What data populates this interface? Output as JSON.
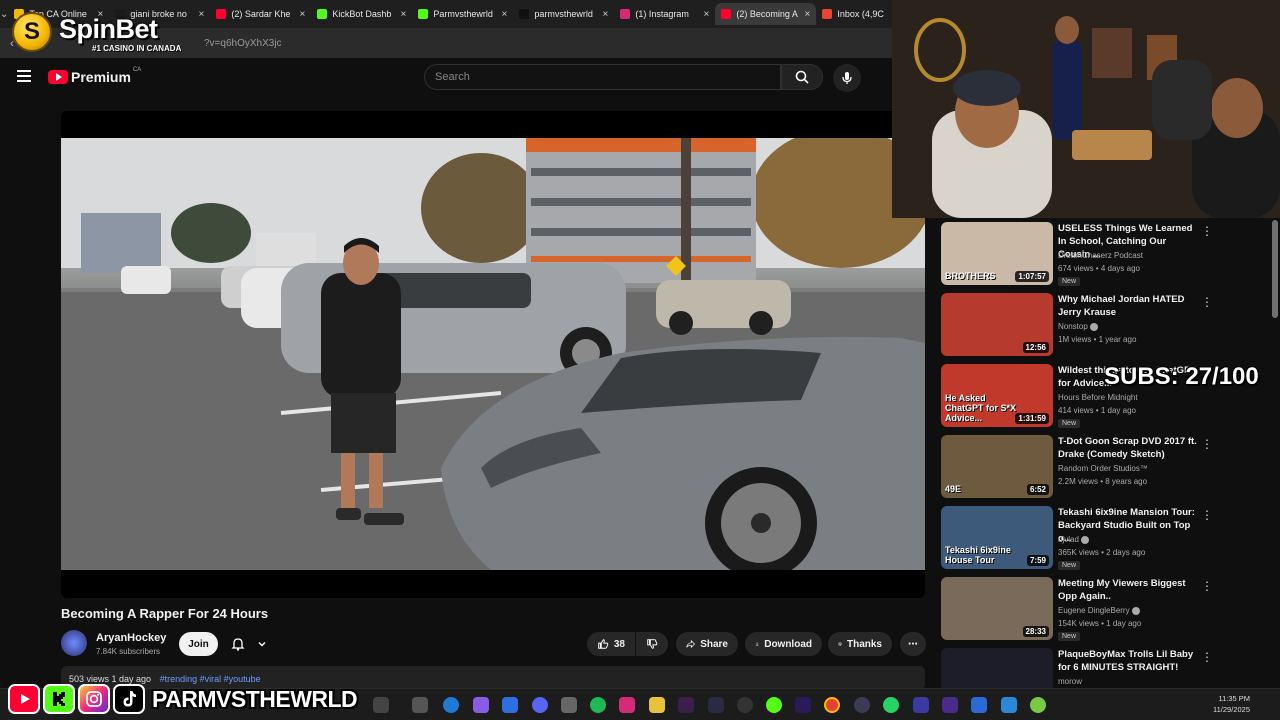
{
  "browser": {
    "tabs": [
      {
        "label": "Top CA Online",
        "fav_color": "#f5b800",
        "active": false
      },
      {
        "label": "giani broke no",
        "fav_color": "#1a1a1a",
        "active": false
      },
      {
        "label": "(2) Sardar Khe",
        "fav_color": "#ff0033",
        "active": false
      },
      {
        "label": "KickBot Dashb",
        "fav_color": "#53fc18",
        "active": false
      },
      {
        "label": "Parmvsthewrld",
        "fav_color": "#53fc18",
        "active": false
      },
      {
        "label": "parmvsthewrld",
        "fav_color": "#111111",
        "active": false
      },
      {
        "label": "(1) Instagram",
        "fav_color": "#d62976",
        "active": false
      },
      {
        "label": "(2) Becoming A",
        "fav_color": "#ff0033",
        "active": true
      },
      {
        "label": "Inbox (4,9C",
        "fav_color": "#ea4335",
        "active": false
      }
    ],
    "close_glyph": "×",
    "url_visible": "?v=q6hOyXhX3jc"
  },
  "overlay_brand": {
    "name": "SpinBet",
    "coin_letter": "S",
    "tagline": "#1 CASINO IN CANADA"
  },
  "youtube": {
    "logo_text": "Premium",
    "region": "CA",
    "search_placeholder": "Search"
  },
  "video": {
    "title": "Becoming A Rapper For 24 Hours",
    "channel": "AryanHockey",
    "subscribers": "7.84K subscribers",
    "join_label": "Join",
    "likes": "38",
    "share_label": "Share",
    "download_label": "Download",
    "thanks_label": "Thanks",
    "more_glyph": "⋯",
    "desc_meta": "503 views  1 day ago",
    "desc_tags": "#trending #viral #youtube"
  },
  "recommendations": [
    {
      "title": "USELESS Things We Learned In School, Catching Our Cousin ...",
      "channel": "DreamChaserz Podcast",
      "verified": false,
      "meta": "674 views • 4 days ago",
      "new": true,
      "duration": "1:07:57",
      "thumb_text": "BROTHERS",
      "thumb_color": "#c9b9a6"
    },
    {
      "title": "Why Michael Jordan HATED Jerry Krause",
      "channel": "Nonstop",
      "verified": true,
      "meta": "1M views • 1 year ago",
      "new": false,
      "duration": "12:56",
      "thumb_text": "",
      "thumb_color": "#b73a2e"
    },
    {
      "title": "Wildest things to ask ChatGPT for Advice...",
      "channel": "Hours Before Midnight",
      "verified": false,
      "meta": "414 views • 1 day ago",
      "new": true,
      "duration": "1:31:59",
      "thumb_text": "He Asked ChatGPT for S*X Advice...",
      "thumb_color": "#c0392b"
    },
    {
      "title": "T-Dot Goon Scrap DVD 2017 ft. Drake (Comedy Sketch)",
      "channel": "Random Order Studios™",
      "verified": false,
      "meta": "2.2M views • 8 years ago",
      "new": false,
      "duration": "6:52",
      "thumb_text": "49E",
      "thumb_color": "#6d5a3f"
    },
    {
      "title": "Tekashi 6ix9ine Mansion Tour: Backyard Studio Built on Top o...",
      "channel": "djvlad",
      "verified": true,
      "meta": "365K views • 2 days ago",
      "new": true,
      "duration": "7:59",
      "thumb_text": "Tekashi 6ix9ine House Tour",
      "thumb_color": "#3d5a7a"
    },
    {
      "title": "Meeting My Viewers Biggest Opp Again..",
      "channel": "Eugene DingleBerry",
      "verified": true,
      "meta": "154K views • 1 day ago",
      "new": true,
      "duration": "28:33",
      "thumb_text": "",
      "thumb_color": "#7a6a5a"
    },
    {
      "title": "PlaqueBoyMax Trolls Lil Baby for 6 MINUTES STRAIGHT!",
      "channel": "morow",
      "verified": false,
      "meta": "",
      "new": false,
      "duration": "",
      "thumb_text": "",
      "thumb_color": "#1d1d2a"
    }
  ],
  "new_badge": "New",
  "stream_overlay": {
    "subs_text": "SUBS: 27/100",
    "handle": "PARMVSTHEWRLD"
  },
  "taskbar": {
    "time": "11:35 PM",
    "date": "11/29/2025"
  },
  "colors": {
    "youtube_red": "#ff0033",
    "kick_green": "#53fc18",
    "background": "#0f0f0f",
    "pill": "#272727"
  }
}
